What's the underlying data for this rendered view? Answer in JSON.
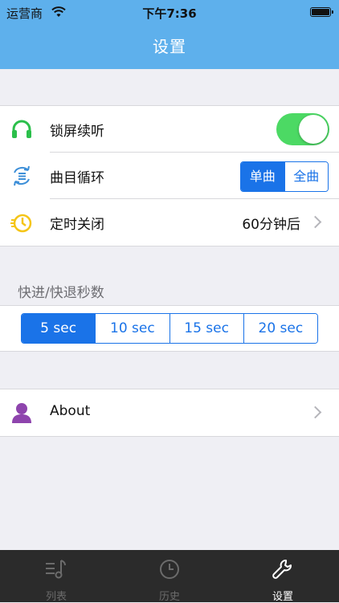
{
  "status_bar": {
    "carrier": "运营商",
    "time": "下午7:36"
  },
  "nav": {
    "title": "设置"
  },
  "settings": {
    "lock_screen": {
      "label": "锁屏续听",
      "toggle_on": true
    },
    "loop": {
      "label": "曲目循环",
      "options": [
        "单曲",
        "全曲"
      ],
      "selected": "单曲"
    },
    "timer": {
      "label": "定时关闭",
      "value": "60分钟后"
    }
  },
  "skip": {
    "header": "快进/快退秒数",
    "options": [
      "5 sec",
      "10 sec",
      "15 sec",
      "20 sec"
    ],
    "selected": "5 sec"
  },
  "about": {
    "label": "About"
  },
  "tabs": [
    {
      "label": "列表",
      "icon": "music-list-icon",
      "active": false
    },
    {
      "label": "历史",
      "icon": "clock-icon",
      "active": false
    },
    {
      "label": "设置",
      "icon": "wrench-icon",
      "active": true
    }
  ],
  "colors": {
    "nav_bg": "#5eb0ec",
    "accent_blue": "#1a73e8",
    "toggle_green": "#4cd964",
    "headphone_green": "#2bbf4b",
    "timer_yellow": "#f5c518",
    "about_purple": "#8e44ad",
    "tabbar_bg": "#2b2b2b"
  }
}
